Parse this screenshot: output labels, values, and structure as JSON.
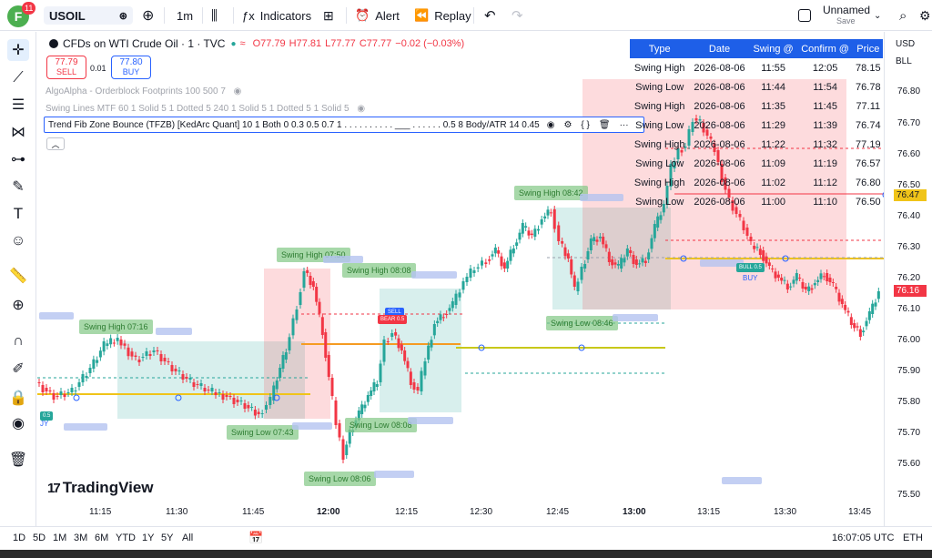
{
  "topbar": {
    "avatar_letter": "F",
    "notifications": "11",
    "symbol": "USOIL",
    "interval": "1m",
    "indicators": "Indicators",
    "alert": "Alert",
    "replay": "Replay",
    "layout_name": "Unnamed",
    "layout_status": "Save"
  },
  "legend": {
    "title": "CFDs on WTI Crude Oil · 1 · TVC",
    "open": "O77.79",
    "high": "H77.81",
    "low": "L77.77",
    "close": "C77.77",
    "change": "−0.02 (−0.03%)",
    "sell_price": "77.79",
    "sell_label": "SELL",
    "spread": "0.01",
    "buy_price": "77.80",
    "buy_label": "BUY"
  },
  "indicators": [
    "AlgoAlpha - Orderblock Footprints 100 500 7",
    "Swing Lines MTF 60 1 Solid 5 1 Dotted 5 240 1 Solid 5 1 Dotted 5 1 Solid 5",
    "Trend Fib Zone Bounce (TFZB) [KedArc Quant] 10 1 Both 0 0.3 0.5 0.7 1 . . . . . . . . . . ___ . . . . . . 0.5 8 Body/ATR 14 0.45"
  ],
  "swing_table": {
    "headers": [
      "Type",
      "Date",
      "Swing @",
      "Confirm @",
      "Price"
    ],
    "rows": [
      [
        "Swing High",
        "2026-08-06",
        "11:55",
        "12:05",
        "78.15"
      ],
      [
        "Swing Low",
        "2026-08-06",
        "11:44",
        "11:54",
        "76.78"
      ],
      [
        "Swing High",
        "2026-08-06",
        "11:35",
        "11:45",
        "77.11"
      ],
      [
        "Swing Low",
        "2026-08-06",
        "11:29",
        "11:39",
        "76.74"
      ],
      [
        "Swing High",
        "2026-08-06",
        "11:22",
        "11:32",
        "77.19"
      ],
      [
        "Swing Low",
        "2026-08-06",
        "11:09",
        "11:19",
        "76.57"
      ],
      [
        "Swing High",
        "2026-08-06",
        "11:02",
        "11:12",
        "76.80"
      ],
      [
        "Swing Low",
        "2026-08-06",
        "11:00",
        "11:10",
        "76.50"
      ]
    ]
  },
  "price_axis": {
    "currency": "USD",
    "unit": "BLL",
    "labels": [
      "76.80",
      "76.70",
      "76.60",
      "76.50",
      "76.40",
      "76.30",
      "76.20",
      "76.10",
      "76.00",
      "75.90",
      "75.80",
      "75.70",
      "75.60",
      "75.50"
    ],
    "tag_upper": "76.47",
    "tag_current": "76.16"
  },
  "time_axis": {
    "labels": [
      "11:15",
      "11:30",
      "11:45",
      "12:00",
      "12:15",
      "12:30",
      "12:45",
      "13:00",
      "13:15",
      "13:30",
      "13:45"
    ]
  },
  "chart_labels": {
    "swing_high_1": "Swing High 07:16",
    "swing_high_2": "Swing High 07:50",
    "swing_high_3": "Swing High 08:08",
    "swing_high_4": "Swing High 08:42",
    "swing_low_1": "Swing Low 07:43",
    "swing_low_2": "Swing Low 08:08",
    "swing_low_3": "Swing Low 08:06",
    "swing_low_4": "Swing Low 08:46",
    "sell_label": "SELL",
    "bear_label": "BEAR 0.5",
    "bull_label": "BULL 0.5",
    "buy_label": "BUY",
    "buy_left": "JY",
    "tag_left": "0.5"
  },
  "brand": "TradingView",
  "bottombar": {
    "ranges": [
      "1D",
      "5D",
      "1M",
      "3M",
      "6M",
      "YTD",
      "1Y",
      "5Y",
      "All"
    ],
    "clock": "16:07:05 UTC",
    "session": "ETH"
  },
  "colors": {
    "accent": "#2962ff",
    "up": "#26a69a",
    "down": "#f23645",
    "table_header": "#1e5fe8"
  },
  "icons": [
    "crosshair-icon",
    "trendline-icon",
    "fib-icon",
    "pattern-icon",
    "text-icon",
    "brush-icon",
    "emoji-icon",
    "ruler-icon",
    "zoom-icon",
    "magnet-icon",
    "lock-icon",
    "eye-icon",
    "trash-icon"
  ]
}
